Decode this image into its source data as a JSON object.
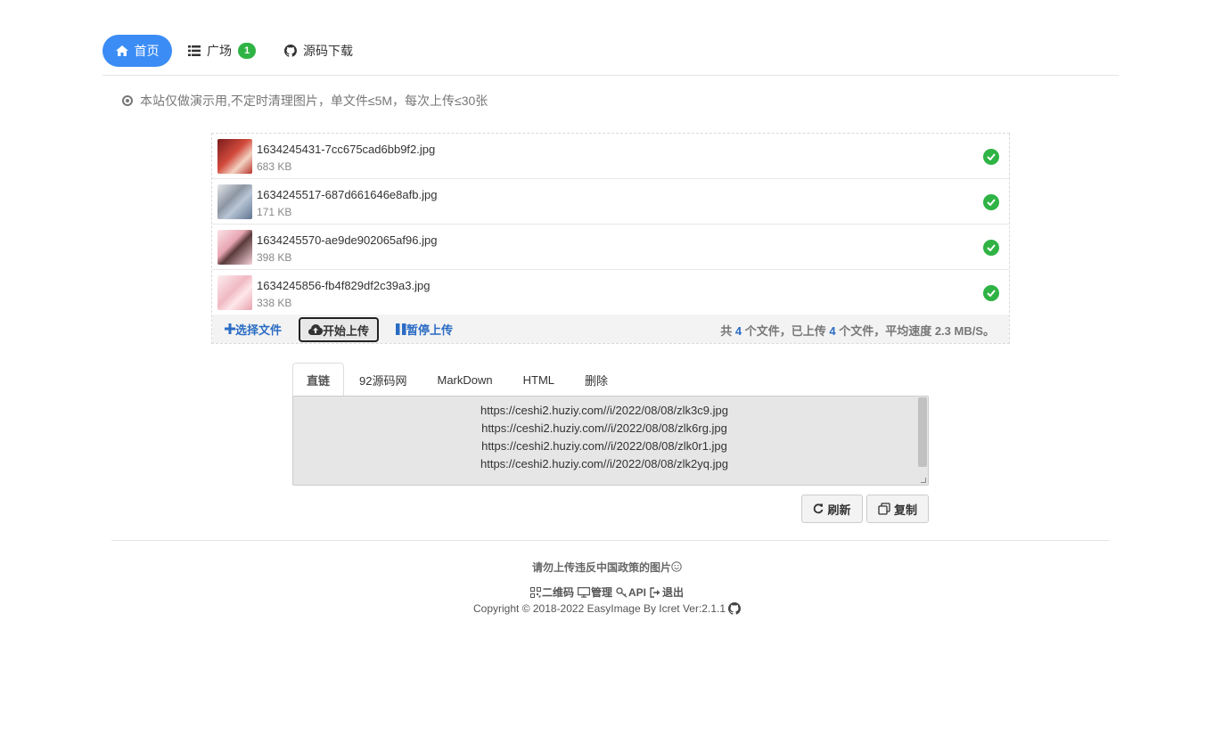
{
  "nav": {
    "home": "首页",
    "square": "广场",
    "square_badge": "1",
    "source": "源码下载"
  },
  "notice": "本站仅做演示用,不定时清理图片，单文件≤5M，每次上传≤30张",
  "files": [
    {
      "name": "1634245431-7cc675cad6bb9f2.jpg",
      "size": "683 KB",
      "thumb_color": "#c0423a"
    },
    {
      "name": "1634245517-687d661646e8afb.jpg",
      "size": "171 KB",
      "thumb_color": "#9aa7b5"
    },
    {
      "name": "1634245570-ae9de902065af96.jpg",
      "size": "398 KB",
      "thumb_color": "#e9b7c0"
    },
    {
      "name": "1634245856-fb4f829df2c39a3.jpg",
      "size": "338 KB",
      "thumb_color": "#f2c6cc"
    }
  ],
  "toolbar": {
    "select": "选择文件",
    "start": "开始上传",
    "pause": "暂停上传",
    "stats_prefix": "共",
    "total": "4",
    "stats_mid": "个文件，已上传",
    "uploaded": "4",
    "stats_suffix": "个文件，平均速度 2.3 MB/S。"
  },
  "tabs": [
    "直链",
    "92源码网",
    "MarkDown",
    "HTML",
    "删除"
  ],
  "links": [
    "https://ceshi2.huziy.com//i/2022/08/08/zlk3c9.jpg",
    "https://ceshi2.huziy.com//i/2022/08/08/zlk6rg.jpg",
    "https://ceshi2.huziy.com//i/2022/08/08/zlk0r1.jpg",
    "https://ceshi2.huziy.com//i/2022/08/08/zlk2yq.jpg"
  ],
  "buttons": {
    "refresh": "刷新",
    "copy": "复制"
  },
  "footer": {
    "warning": "请勿上传违反中国政策的图片",
    "qrcode": "二维码",
    "admin": "管理",
    "api": "API",
    "logout": "退出",
    "copyright": "Copyright © 2018-2022 EasyImage By Icret Ver:2.1.1"
  },
  "colors": {
    "primary": "#3b8cf5",
    "success": "#2fb344",
    "link": "#2b6cc4"
  },
  "icons": [
    "home-icon",
    "list-icon",
    "github-icon",
    "check-circle-icon",
    "plus-icon",
    "cloud-upload-icon",
    "pause-icon",
    "refresh-icon",
    "copy-icon",
    "smile-icon",
    "qrcode-icon",
    "monitor-icon",
    "key-icon",
    "logout-icon"
  ]
}
